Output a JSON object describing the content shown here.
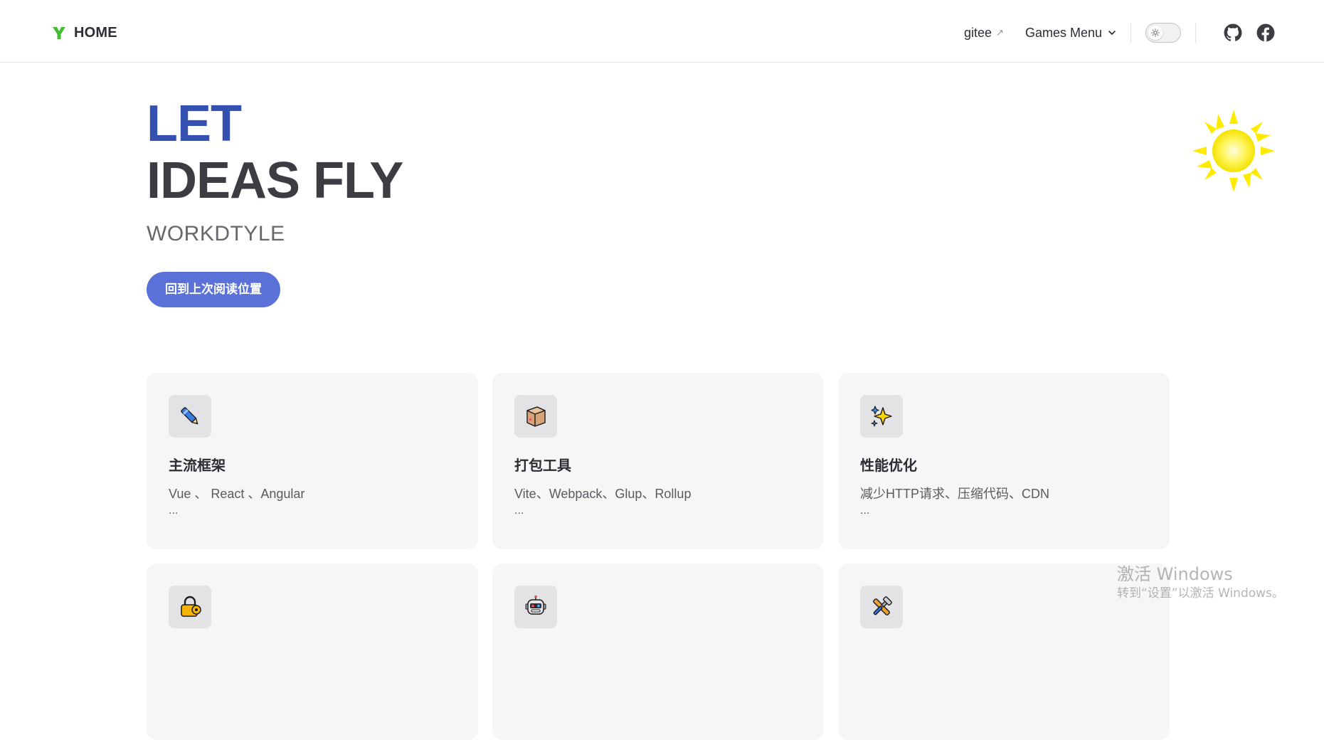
{
  "navbar": {
    "brand_title": "HOME",
    "links": [
      {
        "label": "gitee",
        "external": true
      },
      {
        "label": "Games Menu"
      }
    ],
    "theme_toggle": {
      "mode": "light"
    },
    "social": [
      "github-icon",
      "facebook-icon"
    ]
  },
  "hero": {
    "name": "LET",
    "text": "IDEAS FLY",
    "tagline": "WORKDTYLE",
    "action_label": "回到上次阅读位置"
  },
  "features": [
    {
      "icon": "pen-icon",
      "title": "主流框架",
      "details": "Vue 、 React 、Angular",
      "more": "..."
    },
    {
      "icon": "package-icon",
      "title": "打包工具",
      "details": "Vite、Webpack、Glup、Rollup",
      "more": "..."
    },
    {
      "icon": "sparkles-icon",
      "title": "性能优化",
      "details": "减少HTTP请求、压缩代码、CDN",
      "more": "..."
    },
    {
      "icon": "lock-icon",
      "title": "",
      "details": "",
      "more": ""
    },
    {
      "icon": "robot-icon",
      "title": "",
      "details": "",
      "more": ""
    },
    {
      "icon": "tools-icon",
      "title": "",
      "details": "",
      "more": ""
    }
  ],
  "watermark": {
    "line1": "激活 Windows",
    "line2": "转到“设置”以激活 Windows。"
  },
  "colors": {
    "accent": "#3451b2",
    "button": "#5a72d8",
    "card_bg": "#f6f6f7",
    "logo_green": "#44bd32"
  }
}
